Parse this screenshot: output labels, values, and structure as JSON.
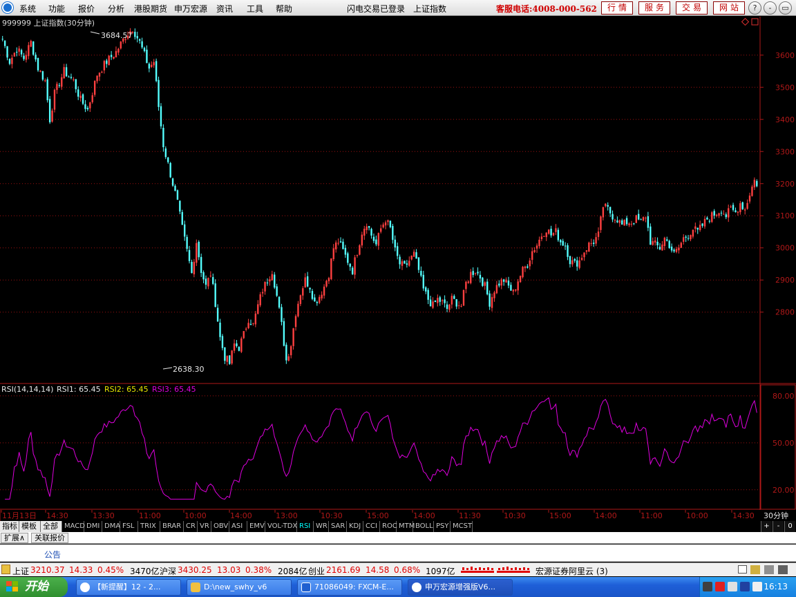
{
  "menu": {
    "items": [
      "系统",
      "功能",
      "报价",
      "分析",
      "港股期货",
      "申万宏源",
      "资讯",
      "工具",
      "帮助"
    ],
    "login_status": "闪电交易已登录",
    "index_name": "上证指数",
    "phone": "客服电话:4008-000-562",
    "quick_buttons": [
      "行情",
      "服务",
      "交易",
      "网站"
    ],
    "window_controls": [
      "?",
      "-",
      "▭",
      "✕"
    ]
  },
  "chart_title": "999999 上证指数(30分钟)",
  "colors": {
    "up": "#ff4040",
    "down": "#54ffff",
    "rsi1": "#e000e0",
    "axis": "#b01818",
    "grid": "#a01010",
    "rsi1_label": "#e8e8e8",
    "rsi2_label": "#e8e800",
    "rsi3_label": "#e000e0"
  },
  "price": {
    "high_label": "3684.57",
    "low_label": "2638.30",
    "y_ticks": [
      3600,
      3500,
      3400,
      3300,
      3200,
      3100,
      3000,
      2900,
      2800
    ],
    "y_range": [
      2580,
      3720
    ],
    "anchors": [
      [
        0,
        3650
      ],
      [
        3,
        3580
      ],
      [
        6,
        3620
      ],
      [
        9,
        3590
      ],
      [
        12,
        3640
      ],
      [
        15,
        3560
      ],
      [
        18,
        3520
      ],
      [
        20,
        3400
      ],
      [
        22,
        3480
      ],
      [
        26,
        3550
      ],
      [
        30,
        3520
      ],
      [
        33,
        3460
      ],
      [
        36,
        3430
      ],
      [
        40,
        3540
      ],
      [
        44,
        3580
      ],
      [
        48,
        3610
      ],
      [
        52,
        3660
      ],
      [
        55,
        3684
      ],
      [
        58,
        3640
      ],
      [
        62,
        3560
      ],
      [
        64,
        3580
      ],
      [
        66,
        3440
      ],
      [
        68,
        3320
      ],
      [
        70,
        3260
      ],
      [
        72,
        3200
      ],
      [
        74,
        3140
      ],
      [
        76,
        3060
      ],
      [
        78,
        2990
      ],
      [
        80,
        2920
      ],
      [
        82,
        3020
      ],
      [
        84,
        2930
      ],
      [
        86,
        2880
      ],
      [
        88,
        2920
      ],
      [
        90,
        2830
      ],
      [
        92,
        2720
      ],
      [
        94,
        2660
      ],
      [
        96,
        2640
      ],
      [
        98,
        2700
      ],
      [
        100,
        2690
      ],
      [
        102,
        2730
      ],
      [
        104,
        2780
      ],
      [
        106,
        2760
      ],
      [
        108,
        2820
      ],
      [
        110,
        2870
      ],
      [
        112,
        2900
      ],
      [
        114,
        2930
      ],
      [
        116,
        2850
      ],
      [
        118,
        2760
      ],
      [
        120,
        2650
      ],
      [
        122,
        2700
      ],
      [
        124,
        2800
      ],
      [
        126,
        2860
      ],
      [
        128,
        2900
      ],
      [
        130,
        2880
      ],
      [
        132,
        2830
      ],
      [
        134,
        2850
      ],
      [
        136,
        2880
      ],
      [
        138,
        2920
      ],
      [
        140,
        3000
      ],
      [
        142,
        3020
      ],
      [
        144,
        2990
      ],
      [
        146,
        2960
      ],
      [
        148,
        2930
      ],
      [
        150,
        2990
      ],
      [
        152,
        3050
      ],
      [
        154,
        3080
      ],
      [
        156,
        3040
      ],
      [
        158,
        3010
      ],
      [
        160,
        3060
      ],
      [
        162,
        3090
      ],
      [
        164,
        3060
      ],
      [
        166,
        2990
      ],
      [
        168,
        2950
      ],
      [
        170,
        2940
      ],
      [
        172,
        2960
      ],
      [
        174,
        2980
      ],
      [
        176,
        2930
      ],
      [
        178,
        2870
      ],
      [
        180,
        2840
      ],
      [
        182,
        2820
      ],
      [
        184,
        2840
      ],
      [
        186,
        2830
      ],
      [
        188,
        2810
      ],
      [
        190,
        2840
      ],
      [
        192,
        2830
      ],
      [
        194,
        2820
      ],
      [
        196,
        2890
      ],
      [
        198,
        2920
      ],
      [
        200,
        2930
      ],
      [
        202,
        2910
      ],
      [
        204,
        2880
      ],
      [
        206,
        2830
      ],
      [
        208,
        2870
      ],
      [
        210,
        2890
      ],
      [
        212,
        2900
      ],
      [
        214,
        2880
      ],
      [
        216,
        2860
      ],
      [
        218,
        2900
      ],
      [
        220,
        2930
      ],
      [
        222,
        2950
      ],
      [
        224,
        2990
      ],
      [
        226,
        3010
      ],
      [
        228,
        3040
      ],
      [
        230,
        3060
      ],
      [
        232,
        3040
      ],
      [
        234,
        3050
      ],
      [
        236,
        3020
      ],
      [
        238,
        3010
      ],
      [
        240,
        2960
      ],
      [
        242,
        2950
      ],
      [
        244,
        2960
      ],
      [
        246,
        2990
      ],
      [
        248,
        3010
      ],
      [
        250,
        3020
      ],
      [
        252,
        3040
      ],
      [
        254,
        3130
      ],
      [
        256,
        3120
      ],
      [
        258,
        3100
      ],
      [
        260,
        3090
      ],
      [
        262,
        3070
      ],
      [
        264,
        3080
      ],
      [
        266,
        3080
      ],
      [
        268,
        3090
      ],
      [
        270,
        3080
      ],
      [
        272,
        3100
      ],
      [
        274,
        3020
      ],
      [
        276,
        3010
      ],
      [
        278,
        3000
      ],
      [
        280,
        3030
      ],
      [
        282,
        3010
      ],
      [
        284,
        2980
      ],
      [
        286,
        3000
      ],
      [
        288,
        3030
      ],
      [
        290,
        3040
      ],
      [
        292,
        3060
      ],
      [
        294,
        3050
      ],
      [
        296,
        3070
      ],
      [
        298,
        3090
      ],
      [
        300,
        3100
      ],
      [
        302,
        3110
      ],
      [
        304,
        3120
      ],
      [
        306,
        3100
      ],
      [
        308,
        3120
      ],
      [
        310,
        3110
      ],
      [
        312,
        3140
      ],
      [
        314,
        3120
      ],
      [
        316,
        3170
      ],
      [
        318,
        3210
      ],
      [
        319,
        3200
      ]
    ]
  },
  "rsi": {
    "label": "RSI(14,14,14)",
    "rsi1": "RSI1: 65.45",
    "rsi2": "RSI2: 65.45",
    "rsi3": "RSI3: 65.45",
    "y_ticks": [
      80,
      50,
      20
    ],
    "y_range": [
      8,
      87
    ]
  },
  "time_labels": [
    "11月13日",
    "14:30",
    "13:30",
    "11:00",
    "10:00",
    "14:00",
    "13:00",
    "10:30",
    "15:00",
    "14:00",
    "11:30",
    "10:30",
    "15:00",
    "14:00",
    "11:00",
    "10:00",
    "14:30"
  ],
  "period": "30分钟",
  "indicator_tabs": [
    "指标",
    "模板",
    "全部",
    "MACD",
    "DMI",
    "DMA",
    "FSL",
    "TRIX",
    "BRAR",
    "CR",
    "VR",
    "OBV",
    "ASI",
    "EMV",
    "VOL-TDX",
    "RSI",
    "WR",
    "SAR",
    "KDJ",
    "CCI",
    "ROC",
    "MTM",
    "BOLL",
    "PSY",
    "MCST"
  ],
  "indicator_right": [
    "+",
    "-",
    "0"
  ],
  "extension_tabs": [
    "扩展∧",
    "关联报价"
  ],
  "notice": "公告",
  "status": {
    "sh_label": "上证",
    "sh_value": "3210.37",
    "sh_change": "14.33",
    "sh_pct": "0.45%",
    "sh_amount": "3470亿",
    "hs_label": "沪深",
    "hs_value": "3430.25",
    "hs_change": "13.03",
    "hs_pct": "0.38%",
    "hs_amount": "2084亿",
    "cy_label": "创业",
    "cy_value": "2161.69",
    "cy_change": "14.58",
    "cy_pct": "0.68%",
    "cy_amount": "1097亿",
    "server": "宏源证券阿里云 (3)"
  },
  "taskbar": {
    "start": "开始",
    "tasks": [
      "【新提醒】12 - 2...",
      "D:\\new_swhy_v6",
      "71086049: FXCM-E...",
      "申万宏源增强版V6..."
    ],
    "clock": "16:13"
  }
}
